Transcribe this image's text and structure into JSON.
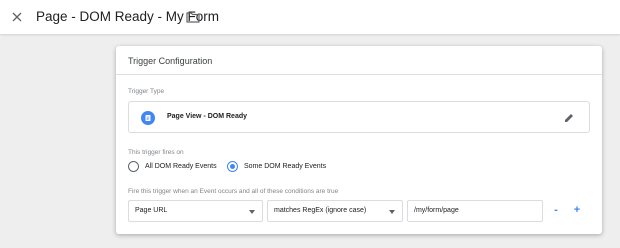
{
  "header": {
    "title": "Page - DOM Ready - My Form"
  },
  "card": {
    "title": "Trigger Configuration",
    "trigger_type_label": "Trigger Type",
    "trigger_type_name": "Page View - DOM Ready",
    "fires_on_label": "This trigger fires on",
    "options": [
      {
        "label": "All DOM Ready Events",
        "selected": false
      },
      {
        "label": "Some DOM Ready Events",
        "selected": true
      }
    ],
    "condition_label": "Fire this trigger when an Event occurs and all of these conditions are true",
    "condition": {
      "variable": "Page URL",
      "operator": "matches RegEx (ignore case)",
      "value": "/my/form/page"
    },
    "remove_label": "-",
    "add_label": "+"
  },
  "colors": {
    "accent": "#4285f4",
    "background": "#eeeeee"
  },
  "icons": [
    "close-icon",
    "folder-icon",
    "page-view-icon",
    "pencil-icon",
    "caret-down-icon"
  ]
}
